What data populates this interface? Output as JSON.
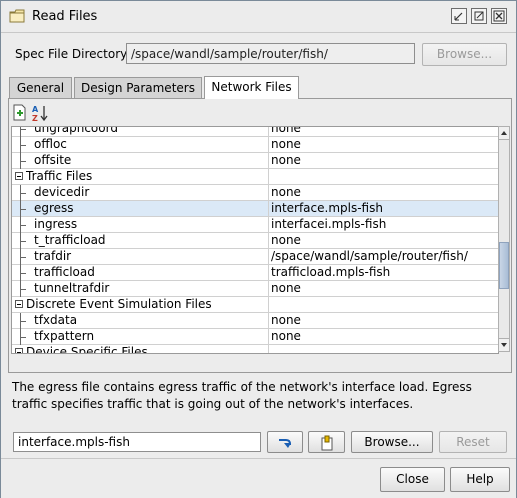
{
  "window": {
    "title": "Read Files"
  },
  "spec": {
    "label": "Spec File Directory:",
    "value": "/space/wandl/sample/router/fish/",
    "browse_label": "Browse..."
  },
  "tabs": [
    {
      "label": "General",
      "active": false
    },
    {
      "label": "Design Parameters",
      "active": false
    },
    {
      "label": "Network Files",
      "active": true
    }
  ],
  "toolbar": {
    "icons": [
      "add-file-icon",
      "sort-az-icon"
    ]
  },
  "table": {
    "rows": [
      {
        "kind": "child",
        "name": "ungraphcoord",
        "value": "none"
      },
      {
        "kind": "child",
        "name": "offloc",
        "value": "none"
      },
      {
        "kind": "child",
        "name": "offsite",
        "value": "none"
      },
      {
        "kind": "group",
        "name": "Traffic Files",
        "value": ""
      },
      {
        "kind": "child",
        "name": "devicedir",
        "value": "none"
      },
      {
        "kind": "child",
        "name": "egress",
        "value": "interface.mpls-fish",
        "selected": true
      },
      {
        "kind": "child",
        "name": "ingress",
        "value": "interfacei.mpls-fish"
      },
      {
        "kind": "child",
        "name": "t_trafficload",
        "value": "none"
      },
      {
        "kind": "child",
        "name": "trafdir",
        "value": "/space/wandl/sample/router/fish/"
      },
      {
        "kind": "child",
        "name": "trafficload",
        "value": "trafficload.mpls-fish"
      },
      {
        "kind": "child",
        "name": "tunneltrafdir",
        "value": "none"
      },
      {
        "kind": "group",
        "name": "Discrete Event Simulation Files",
        "value": ""
      },
      {
        "kind": "child",
        "name": "tfxdata",
        "value": "none"
      },
      {
        "kind": "child",
        "name": "tfxpattern",
        "value": "none"
      },
      {
        "kind": "group",
        "name": "Device Specific Files",
        "value": ""
      }
    ]
  },
  "description": "The egress file contains egress traffic of the network's interface load. Egress traffic specifies traffic that is going out of the network's interfaces.",
  "editor": {
    "value": "interface.mpls-fish",
    "browse_label": "Browse...",
    "reset_label": "Reset"
  },
  "footer": {
    "close_label": "Close",
    "help_label": "Help"
  },
  "colors": {
    "selection": "#dbe9f7",
    "accent": "#1a5fb4"
  }
}
